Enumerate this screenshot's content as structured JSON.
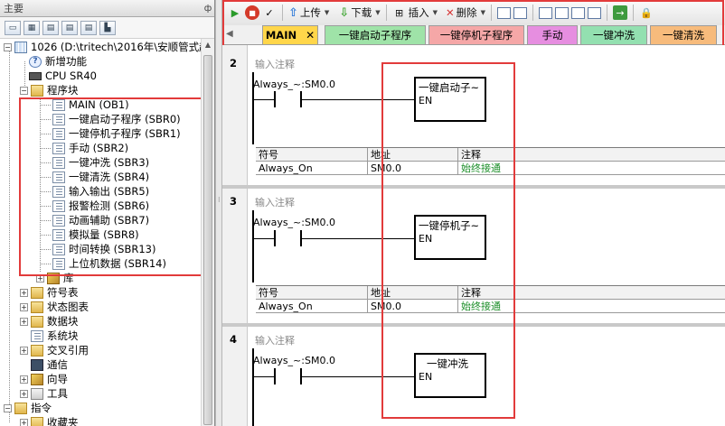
{
  "left_pane": {
    "title": "主要",
    "pin": "ф",
    "tools": [
      "▭",
      "▦",
      "▤",
      "▤",
      "▤",
      "▙"
    ],
    "tree": [
      {
        "label": "1026 (D:\\tritech\\2016年\\安顺管式超",
        "icon": "project"
      },
      {
        "label": "新增功能",
        "icon": "help"
      },
      {
        "label": "CPU SR40",
        "icon": "plc"
      },
      {
        "label": "程序块",
        "icon": "folder"
      },
      {
        "label": "MAIN (OB1)",
        "icon": "doc"
      },
      {
        "label": "一键启动子程序 (SBR0)",
        "icon": "doc"
      },
      {
        "label": "一键停机子程序 (SBR1)",
        "icon": "doc"
      },
      {
        "label": "手动 (SBR2)",
        "icon": "doc"
      },
      {
        "label": "一键冲洗 (SBR3)",
        "icon": "doc"
      },
      {
        "label": "一键清洗 (SBR4)",
        "icon": "doc"
      },
      {
        "label": "输入输出 (SBR5)",
        "icon": "doc"
      },
      {
        "label": "报警检测 (SBR6)",
        "icon": "doc"
      },
      {
        "label": "动画辅助 (SBR7)",
        "icon": "doc"
      },
      {
        "label": "模拟量 (SBR8)",
        "icon": "doc"
      },
      {
        "label": "时间转换 (SBR13)",
        "icon": "doc"
      },
      {
        "label": "上位机数据 (SBR14)",
        "icon": "doc"
      },
      {
        "label": "库",
        "icon": "wizard"
      },
      {
        "label": "符号表",
        "icon": "folder"
      },
      {
        "label": "状态图表",
        "icon": "folder"
      },
      {
        "label": "数据块",
        "icon": "folder"
      },
      {
        "label": "系统块",
        "icon": "doc"
      },
      {
        "label": "交叉引用",
        "icon": "folder"
      },
      {
        "label": "通信",
        "icon": "comm"
      },
      {
        "label": "向导",
        "icon": "wizard"
      },
      {
        "label": "工具",
        "icon": "tool"
      },
      {
        "label": "指令",
        "icon": "folder"
      },
      {
        "label": "收藏夹",
        "icon": "folder"
      }
    ]
  },
  "toolbar": {
    "upload": "上传",
    "download": "下载",
    "insert": "插入",
    "delete": "删除"
  },
  "tabs": [
    {
      "label": "MAIN",
      "style": "main",
      "close": "✕"
    },
    {
      "label": "一键启动子程序",
      "style": "green"
    },
    {
      "label": "一键停机子程序",
      "style": "pink"
    },
    {
      "label": "手动",
      "style": "violet"
    },
    {
      "label": "一键冲洗",
      "style": "mint"
    },
    {
      "label": "一键清洗",
      "style": "peach"
    }
  ],
  "networks": [
    {
      "number": "2",
      "comment": "输入注释",
      "contact": "Always_~:SM0.0",
      "box_title": "一键启动子~",
      "box_en": "EN",
      "table": {
        "headers": [
          "符号",
          "地址",
          "注释"
        ],
        "row": [
          "Always_On",
          "SM0.0",
          "始终接通"
        ]
      }
    },
    {
      "number": "3",
      "comment": "输入注释",
      "contact": "Always_~:SM0.0",
      "box_title": "一键停机子~",
      "box_en": "EN",
      "table": {
        "headers": [
          "符号",
          "地址",
          "注释"
        ],
        "row": [
          "Always_On",
          "SM0.0",
          "始终接通"
        ]
      }
    },
    {
      "number": "4",
      "comment": "输入注释",
      "contact": "Always_~:SM0.0",
      "box_title": "一键冲洗",
      "box_en": "EN"
    }
  ],
  "colors": {
    "highlight_red": "#e23b3b",
    "comment_green": "#1d8f2a",
    "main_tab": "#ffd64a"
  }
}
